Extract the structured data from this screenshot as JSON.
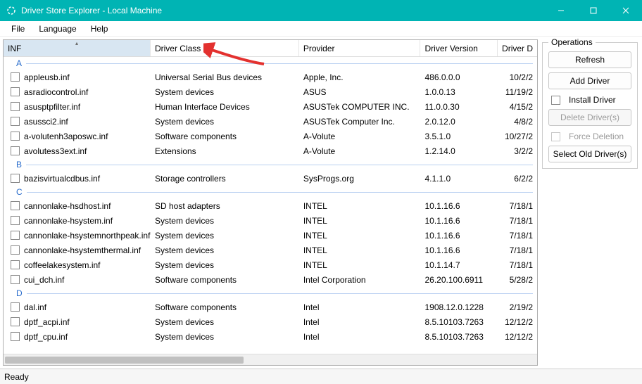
{
  "window": {
    "title": "Driver Store Explorer - Local Machine"
  },
  "menu": {
    "file": "File",
    "language": "Language",
    "help": "Help"
  },
  "columns": {
    "inf": "INF",
    "class": "Driver Class",
    "provider": "Provider",
    "version": "Driver Version",
    "date": "Driver D"
  },
  "groups": [
    {
      "letter": "A",
      "rows": [
        {
          "inf": "appleusb.inf",
          "class": "Universal Serial Bus devices",
          "provider": "Apple, Inc.",
          "version": "486.0.0.0",
          "date": "10/2/2"
        },
        {
          "inf": "asradiocontrol.inf",
          "class": "System devices",
          "provider": "ASUS",
          "version": "1.0.0.13",
          "date": "11/19/2"
        },
        {
          "inf": "asusptpfilter.inf",
          "class": "Human Interface Devices",
          "provider": "ASUSTek COMPUTER INC.",
          "version": "11.0.0.30",
          "date": "4/15/2"
        },
        {
          "inf": "asussci2.inf",
          "class": "System devices",
          "provider": "ASUSTek Computer Inc.",
          "version": "2.0.12.0",
          "date": "4/8/2"
        },
        {
          "inf": "a-volutenh3aposwc.inf",
          "class": "Software components",
          "provider": "A-Volute",
          "version": "3.5.1.0",
          "date": "10/27/2"
        },
        {
          "inf": "avolutess3ext.inf",
          "class": "Extensions",
          "provider": "A-Volute",
          "version": "1.2.14.0",
          "date": "3/2/2"
        }
      ]
    },
    {
      "letter": "B",
      "rows": [
        {
          "inf": "bazisvirtualcdbus.inf",
          "class": "Storage controllers",
          "provider": "SysProgs.org",
          "version": "4.1.1.0",
          "date": "6/2/2"
        }
      ]
    },
    {
      "letter": "C",
      "rows": [
        {
          "inf": "cannonlake-hsdhost.inf",
          "class": "SD host adapters",
          "provider": "INTEL",
          "version": "10.1.16.6",
          "date": "7/18/1"
        },
        {
          "inf": "cannonlake-hsystem.inf",
          "class": "System devices",
          "provider": "INTEL",
          "version": "10.1.16.6",
          "date": "7/18/1"
        },
        {
          "inf": "cannonlake-hsystemnorthpeak.inf",
          "class": "System devices",
          "provider": "INTEL",
          "version": "10.1.16.6",
          "date": "7/18/1"
        },
        {
          "inf": "cannonlake-hsystemthermal.inf",
          "class": "System devices",
          "provider": "INTEL",
          "version": "10.1.16.6",
          "date": "7/18/1"
        },
        {
          "inf": "coffeelakesystem.inf",
          "class": "System devices",
          "provider": "INTEL",
          "version": "10.1.14.7",
          "date": "7/18/1"
        },
        {
          "inf": "cui_dch.inf",
          "class": "Software components",
          "provider": "Intel Corporation",
          "version": "26.20.100.6911",
          "date": "5/28/2"
        }
      ]
    },
    {
      "letter": "D",
      "rows": [
        {
          "inf": "dal.inf",
          "class": "Software components",
          "provider": "Intel",
          "version": "1908.12.0.1228",
          "date": "2/19/2"
        },
        {
          "inf": "dptf_acpi.inf",
          "class": "System devices",
          "provider": "Intel",
          "version": "8.5.10103.7263",
          "date": "12/12/2"
        },
        {
          "inf": "dptf_cpu.inf",
          "class": "System devices",
          "provider": "Intel",
          "version": "8.5.10103.7263",
          "date": "12/12/2"
        }
      ]
    }
  ],
  "operations": {
    "legend": "Operations",
    "refresh": "Refresh",
    "add": "Add Driver",
    "install": "Install Driver",
    "delete": "Delete Driver(s)",
    "force": "Force Deletion",
    "select_old": "Select Old Driver(s)"
  },
  "status": {
    "text": "Ready"
  }
}
